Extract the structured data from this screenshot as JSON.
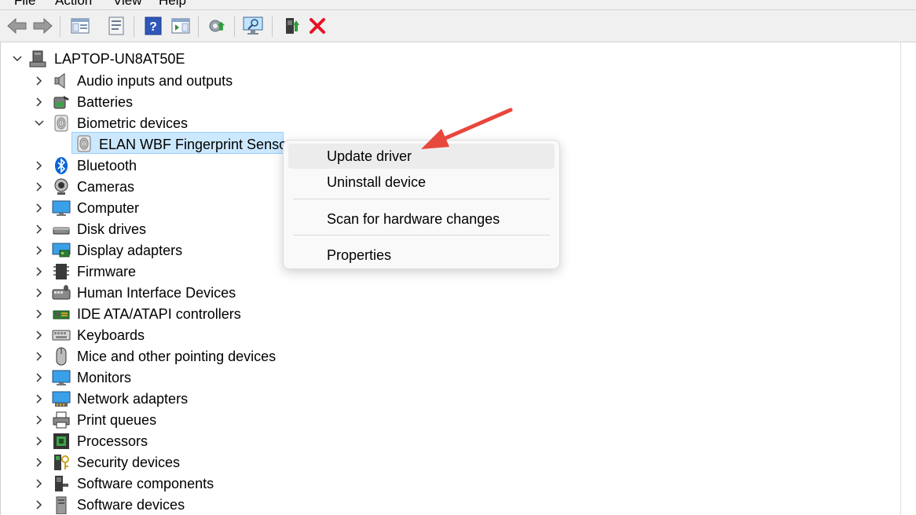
{
  "menubar": {
    "items": [
      "File",
      "Action",
      "View",
      "Help"
    ]
  },
  "toolbar": {
    "icons": [
      "back-arrow-icon",
      "forward-arrow-icon",
      "show-hide-console-tree-icon",
      "properties-icon",
      "help-icon",
      "action-pane-icon",
      "update-driver-icon",
      "scan-hardware-changes-icon",
      "enable-device-icon",
      "uninstall-device-icon"
    ]
  },
  "tree": {
    "root": {
      "label": "LAPTOP-UN8AT50E",
      "icon": "computer-icon"
    },
    "categories": [
      {
        "label": "Audio inputs and outputs",
        "icon": "speaker-icon",
        "expanded": false
      },
      {
        "label": "Batteries",
        "icon": "battery-icon",
        "expanded": false
      },
      {
        "label": "Biometric devices",
        "icon": "fingerprint-icon",
        "expanded": true,
        "children": [
          {
            "label": "ELAN WBF Fingerprint Sensor",
            "icon": "fingerprint-icon",
            "selected": true
          }
        ]
      },
      {
        "label": "Bluetooth",
        "icon": "bluetooth-icon",
        "expanded": false
      },
      {
        "label": "Cameras",
        "icon": "camera-icon",
        "expanded": false
      },
      {
        "label": "Computer",
        "icon": "monitor-icon",
        "expanded": false
      },
      {
        "label": "Disk drives",
        "icon": "disk-drive-icon",
        "expanded": false
      },
      {
        "label": "Display adapters",
        "icon": "display-adapter-icon",
        "expanded": false
      },
      {
        "label": "Firmware",
        "icon": "firmware-chip-icon",
        "expanded": false
      },
      {
        "label": "Human Interface Devices",
        "icon": "hid-icon",
        "expanded": false
      },
      {
        "label": "IDE ATA/ATAPI controllers",
        "icon": "ide-controller-icon",
        "expanded": false
      },
      {
        "label": "Keyboards",
        "icon": "keyboard-icon",
        "expanded": false
      },
      {
        "label": "Mice and other pointing devices",
        "icon": "mouse-icon",
        "expanded": false
      },
      {
        "label": "Monitors",
        "icon": "monitor-icon",
        "expanded": false
      },
      {
        "label": "Network adapters",
        "icon": "network-adapter-icon",
        "expanded": false
      },
      {
        "label": "Print queues",
        "icon": "printer-icon",
        "expanded": false
      },
      {
        "label": "Processors",
        "icon": "processor-icon",
        "expanded": false
      },
      {
        "label": "Security devices",
        "icon": "security-key-icon",
        "expanded": false
      },
      {
        "label": "Software components",
        "icon": "software-component-icon",
        "expanded": false
      },
      {
        "label": "Software devices",
        "icon": "software-device-icon",
        "expanded": false
      }
    ]
  },
  "context_menu": {
    "items": [
      {
        "label": "Update driver",
        "highlighted": true
      },
      {
        "label": "Uninstall device"
      },
      {
        "label": "Scan for hardware changes"
      },
      {
        "label": "Properties"
      }
    ]
  },
  "annotation": {
    "type": "arrow",
    "color": "#e8473b",
    "points_to": "Update driver"
  },
  "colors": {
    "selection_bg": "#cce8ff",
    "selection_border": "#99d1ff",
    "menu_bg": "#f9f9f9",
    "uninstall_red": "#e81123"
  }
}
